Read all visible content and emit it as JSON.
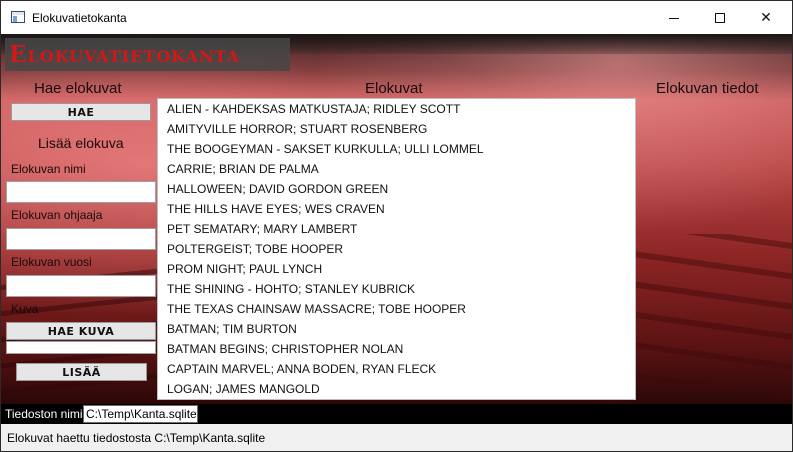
{
  "window": {
    "title": "Elokuvatietokanta",
    "controls": {
      "minimize": "minimize",
      "maximize": "maximize",
      "close": "✕"
    }
  },
  "app": {
    "banner": "Elokuvatietokanta"
  },
  "search_panel": {
    "heading": "Hae elokuvat",
    "search_button": "HAE"
  },
  "add_panel": {
    "heading": "Lisää elokuva",
    "name_label": "Elokuvan nimi",
    "name_value": "",
    "director_label": "Elokuvan ohjaaja",
    "director_value": "",
    "year_label": "Elokuvan vuosi",
    "year_value": "",
    "image_label": "Kuva",
    "image_button": "HAE KUVA",
    "image_value": "",
    "add_button": "LISÄÄ"
  },
  "movies_panel": {
    "heading": "Elokuvat",
    "items": [
      "ALIEN - KAHDEKSAS MATKUSTAJA; RIDLEY SCOTT",
      "AMITYVILLE HORROR; STUART ROSENBERG",
      "THE BOOGEYMAN - SAKSET KURKULLA; ULLI LOMMEL",
      "CARRIE; BRIAN DE PALMA",
      "HALLOWEEN; DAVID GORDON GREEN",
      "THE HILLS HAVE EYES; WES CRAVEN",
      "PET SEMATARY; MARY LAMBERT",
      "POLTERGEIST; TOBE HOOPER",
      "PROM NIGHT; PAUL LYNCH",
      "THE SHINING - HOHTO; STANLEY KUBRICK",
      "THE TEXAS CHAINSAW MASSACRE; TOBE HOOPER",
      "BATMAN; TIM BURTON",
      "BATMAN BEGINS; CHRISTOPHER NOLAN",
      "CAPTAIN MARVEL; ANNA BODEN, RYAN FLECK",
      "LOGAN; JAMES MANGOLD"
    ]
  },
  "details_panel": {
    "heading": "Elokuvan tiedot"
  },
  "file": {
    "label": "Tiedoston nimi",
    "value": "C:\\Temp\\Kanta.sqlite"
  },
  "status": {
    "text": "Elokuvat haettu tiedostosta C:\\Temp\\Kanta.sqlite"
  },
  "colors": {
    "banner_text": "#d21818",
    "banner_bg": "#464646",
    "list_bg": "#ffffff",
    "status_bg": "#f0f0f0"
  }
}
